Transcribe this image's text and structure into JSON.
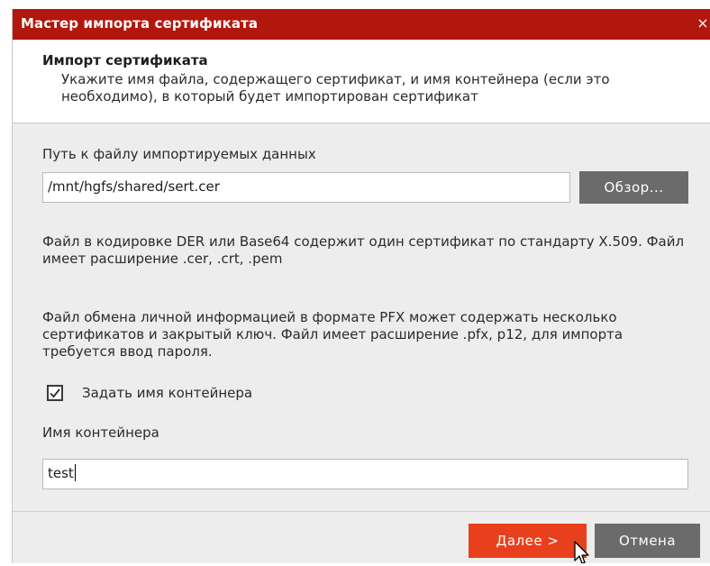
{
  "window": {
    "title": "Мастер импорта сертификата",
    "close_glyph": "×"
  },
  "header": {
    "title": "Импорт сертификата",
    "description": "Укажите имя файла, содержащего сертификат, и имя контейнера (если это необходимо), в который будет импортирован сертификат"
  },
  "file": {
    "label": "Путь к файлу импортируемых данных",
    "value": "/mnt/hgfs/shared/sert.cer",
    "browse_label": "Обзор..."
  },
  "info": {
    "der_text": "Файл в кодировке DER или Base64 содержит один сертификат по стандарту X.509. Файл имеет расширение .cer, .crt, .pem",
    "pfx_text": "Файл обмена личной информацией в формате PFX может содержать несколько сертификатов и закрытый ключ. Файл имеет расширение .pfx, p12, для импорта требуется ввод пароля."
  },
  "container": {
    "checkbox_label": "Задать имя контейнера",
    "checked": true,
    "name_label": "Имя контейнера",
    "name_value": "test"
  },
  "footer": {
    "next_label": "Далее >",
    "cancel_label": "Отмена"
  },
  "colors": {
    "titlebar": "#b2170d",
    "accent_button": "#e8401d",
    "secondary_button": "#6b6b6b",
    "content_bg": "#ededed"
  },
  "icons": {
    "close": "close-icon",
    "check": "checkmark-icon",
    "cursor": "mouse-pointer-icon"
  }
}
